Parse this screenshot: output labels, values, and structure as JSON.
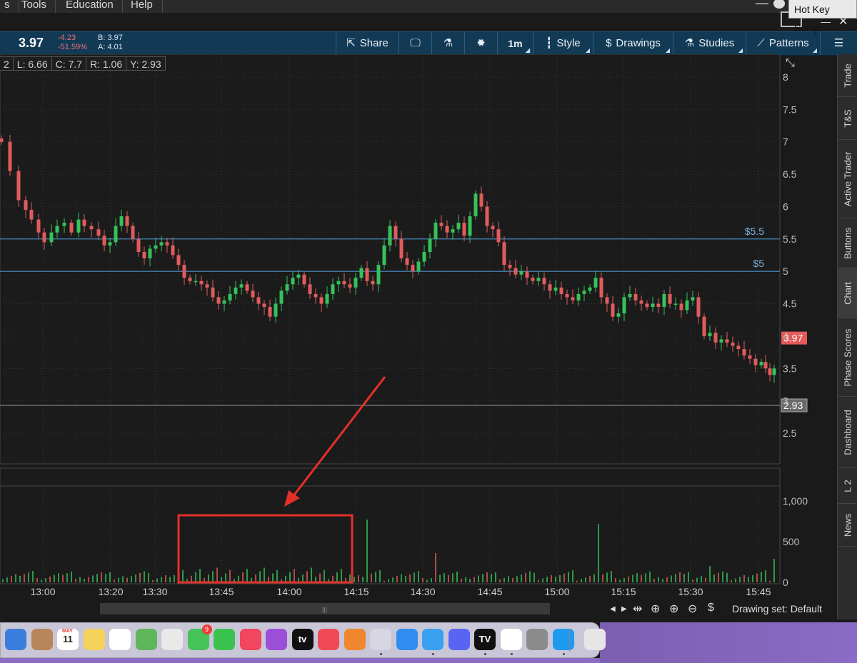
{
  "menu": [
    "s",
    "Tools",
    "Education",
    "Help"
  ],
  "hotkey_tip": "Hot Key Setup",
  "quote": {
    "last": "3.97",
    "change": "-4.23",
    "change_pct": "-51.59%",
    "bid": "B: 3.97",
    "ask": "A: 4.01"
  },
  "toolbar": {
    "share": "Share",
    "share_icon": "share-icon",
    "alert_icon": "alert-icon",
    "flask_icon": "flask-icon",
    "gear_icon": "gear-icon",
    "timeframe": "1m",
    "style": "Style",
    "drawings": "Drawings",
    "studies": "Studies",
    "patterns": "Patterns"
  },
  "ohlc": [
    "2",
    "L: 6.66",
    "C: 7.7",
    "R: 1.06",
    "Y: 2.93"
  ],
  "chart": {
    "price_axis": {
      "min": 2.0,
      "max": 8.0,
      "ticks": [
        "8",
        "7.5",
        "7",
        "6.5",
        "6",
        "5.5",
        "5",
        "4.5",
        "4",
        "3.5",
        "3",
        "2.5"
      ]
    },
    "level_lines": [
      {
        "label": "$5.5",
        "price": 5.5,
        "color": "#4a8fc7"
      },
      {
        "label": "$5",
        "price": 5,
        "color": "#4a8fc7"
      }
    ],
    "last_price_tag": {
      "label": "3.97",
      "price": 3.97,
      "color": "#e45a5a"
    },
    "prev_close_tag": {
      "label": "2.93",
      "price": 2.93
    },
    "time_ticks": [
      "13:00",
      "13:20",
      "13:30",
      "13:45",
      "14:00",
      "14:15",
      "14:30",
      "14:45",
      "15:00",
      "15:15",
      "15:30",
      "15:45"
    ],
    "volume_axis": {
      "max": 1000,
      "ticks": [
        "1,000",
        "500",
        "0"
      ]
    },
    "up_color": "#36c25a",
    "down_color": "#e05c5c"
  },
  "right_tabs": [
    "Trade",
    "T&S",
    "Active Trader",
    "Buttons",
    "Chart",
    "Phase Scores",
    "Dashboard",
    "L 2",
    "News"
  ],
  "active_tab": "Chart",
  "bottom": {
    "drawing_set": "Drawing set: Default"
  },
  "dock": [
    {
      "name": "finder",
      "color": "#3b7ddd",
      "label": ""
    },
    {
      "name": "contacts",
      "color": "#b8865a",
      "label": ""
    },
    {
      "name": "calendar",
      "color": "#ffffff",
      "label": "11",
      "text": "#222"
    },
    {
      "name": "notes",
      "color": "#f3d35a",
      "label": ""
    },
    {
      "name": "reminders",
      "color": "#ffffff",
      "label": "",
      "text": "#222"
    },
    {
      "name": "maps",
      "color": "#5fb55a",
      "label": ""
    },
    {
      "name": "photos",
      "color": "#e9e9e9",
      "label": "",
      "text": "#222"
    },
    {
      "name": "messages",
      "color": "#45c25a",
      "label": ""
    },
    {
      "name": "facetime",
      "color": "#3ac24e",
      "label": ""
    },
    {
      "name": "music",
      "color": "#f24560",
      "label": ""
    },
    {
      "name": "podcasts",
      "color": "#9b4fd6",
      "label": ""
    },
    {
      "name": "tv",
      "color": "#111111",
      "label": "tv"
    },
    {
      "name": "news",
      "color": "#f04a57",
      "label": ""
    },
    {
      "name": "books",
      "color": "#f0872e",
      "label": ""
    },
    {
      "name": "thinkorswim",
      "color": "#d8d6e0",
      "label": "",
      "text": "#2a8f3a"
    },
    {
      "name": "app-store",
      "color": "#2f8cf0",
      "label": ""
    },
    {
      "name": "safari",
      "color": "#3aa0f0",
      "label": ""
    },
    {
      "name": "discord",
      "color": "#5865f2",
      "label": ""
    },
    {
      "name": "tradingview",
      "color": "#111111",
      "label": "TV"
    },
    {
      "name": "app-blue",
      "color": "#ffffff",
      "label": "",
      "text": "#1f5bd6"
    },
    {
      "name": "system-preferences",
      "color": "#8b8b8b",
      "label": ""
    },
    {
      "name": "twitter",
      "color": "#1d9bf0",
      "label": ""
    },
    {
      "name": "trash",
      "color": "#e6e6e6",
      "label": "",
      "text": "#555"
    }
  ],
  "badges": {
    "messages": "9",
    "calendar_month": "MAY"
  }
}
